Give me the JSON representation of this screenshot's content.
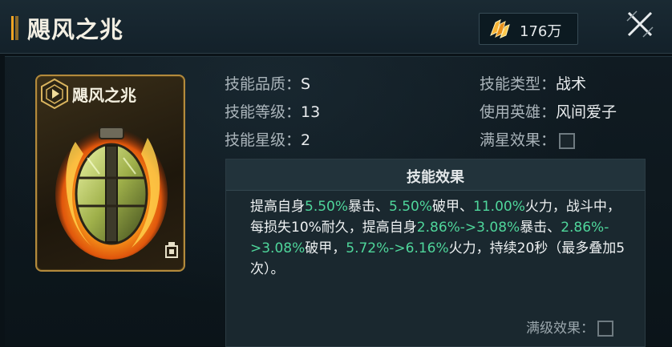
{
  "header": {
    "title": "飓风之兆",
    "currency_value": "176万",
    "currency_icon": "gold-crystal-icon",
    "close_icon": "close-x-icon"
  },
  "card": {
    "name": "飓风之兆",
    "badge_icon": "skill-emblem-icon",
    "art": "flaming-grenade-art",
    "corner_icon": "unit-icon"
  },
  "info": {
    "quality_label": "技能品质：",
    "quality_value": "S",
    "level_label": "技能等级：",
    "level_value": "13",
    "star_label": "技能星级：",
    "star_value": "2",
    "type_label": "技能类型：",
    "type_value": "战术",
    "hero_label": "使用英雄：",
    "hero_value": "风间爱子",
    "full_star_label": "满星效果："
  },
  "effect": {
    "title": "技能效果",
    "segments": [
      {
        "t": "提高自身",
        "g": false
      },
      {
        "t": "5.50%",
        "g": true
      },
      {
        "t": "暴击、",
        "g": false
      },
      {
        "t": "5.50%",
        "g": true
      },
      {
        "t": "破甲、",
        "g": false
      },
      {
        "t": "11.00%",
        "g": true
      },
      {
        "t": "火力，战斗中，每损失10%耐久，提高自身",
        "g": false
      },
      {
        "t": "2.86%->3.08%",
        "g": true
      },
      {
        "t": "暴击、",
        "g": false
      },
      {
        "t": "2.86%->3.08%",
        "g": true
      },
      {
        "t": "破甲，",
        "g": false
      },
      {
        "t": "5.72%->6.16%",
        "g": true
      },
      {
        "t": "火力，持续20秒（最多叠加5次）。",
        "g": false
      }
    ],
    "max_level_label": "满级效果："
  },
  "colors": {
    "highlight": "#4fd69b",
    "accent": "#f0a424",
    "card_border": "#b38a3c"
  }
}
